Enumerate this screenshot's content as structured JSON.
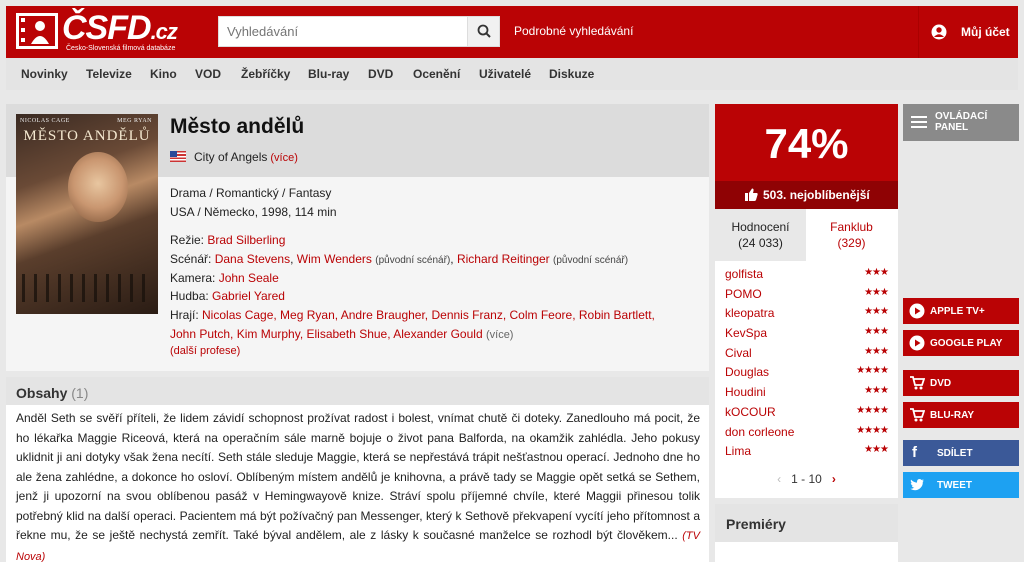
{
  "header": {
    "logo_text": "ČSFD",
    "logo_tld": ".cz",
    "logo_subtitle": "Česko-Slovenská filmová databáze",
    "search_placeholder": "Vyhledávání",
    "advanced_search": "Podrobné vyhledávání",
    "account_label": "Můj účet"
  },
  "nav": [
    "Novinky",
    "Televize",
    "Kino",
    "VOD",
    "Žebříčky",
    "Blu-ray",
    "DVD",
    "Ocenění",
    "Uživatelé",
    "Diskuze"
  ],
  "film": {
    "title": "Město andělů",
    "original_title": "City of Angels",
    "more": "(více)",
    "genres": "Drama / Romantický / Fantasy",
    "origin": "USA / Německo, 1998, 114 min",
    "poster": {
      "actor_left": "NICOLAS CAGE",
      "actor_right": "MEG RYAN",
      "title": "MĚSTO ANDĚLŮ"
    },
    "directing_label": "Režie:",
    "director": "Brad Silberling",
    "screenplay_label": "Scénář:",
    "screenplay_1": "Dana Stevens",
    "screenplay_2": "Wim Wenders",
    "screenplay_note": "(původní scénář)",
    "screenplay_3": "Richard Reitinger",
    "camera_label": "Kamera:",
    "camera": "John Seale",
    "music_label": "Hudba:",
    "music": "Gabriel Yared",
    "cast_label": "Hrají:",
    "cast_line1": "Nicolas Cage, Meg Ryan, Andre Braugher, Dennis Franz, Colm Feore, Robin Bartlett,",
    "cast_line2": "John Putch, Kim Murphy, Elisabeth Shue, Alexander Gould",
    "other_professions": "(další profese)"
  },
  "synopsis": {
    "title": "Obsahy",
    "count": "(1)",
    "text": "Anděl Seth se svěří příteli, že lidem závidí schopnost prožívat radost i bolest, vnímat chutě či doteky. Zanedlouho má pocit, že ho lékařka Maggie Riceová, která na operačním sále marně bojuje o život pana Balforda, na okamžik zahlédla. Jeho pokusy uklidnit ji ani dotyky však žena necítí. Seth stále sleduje Maggie, která se nepřestává trápit nešťastnou operací. Jednoho dne ho ale žena zahlédne, a dokonce ho osloví. Oblíbeným místem andělů je knihovna, a právě tady se Maggie opět setká se Sethem, jenž ji upozorní na svou oblíbenou pasáž v Hemingwayově knize. Stráví spolu příjemné chvíle, které Maggii přinesou tolik potřebný klid na další operaci. Pacientem má být požívačný pan Messenger, který k Sethově překvapení vycítí jeho přítomnost a řekne mu, že se ještě nechystá zemřít. Také býval andělem, ale z lásky k současné manželce se rozhodl být člověkem...",
    "source": "(TV Nova)"
  },
  "rating": {
    "value": "74%",
    "rank": "503. nejoblíbenější",
    "tab_ratings": "Hodnocení",
    "ratings_count": "(24 033)",
    "tab_fanclub": "Fanklub",
    "fanclub_count": "(329)",
    "raters": [
      {
        "name": "golfista",
        "stars": "★★★"
      },
      {
        "name": "POMO",
        "stars": "★★★"
      },
      {
        "name": "kleopatra",
        "stars": "★★★"
      },
      {
        "name": "KevSpa",
        "stars": "★★★"
      },
      {
        "name": "Cival",
        "stars": "★★★"
      },
      {
        "name": "Douglas",
        "stars": "★★★★"
      },
      {
        "name": "Houdini",
        "stars": "★★★"
      },
      {
        "name": "kOCOUR",
        "stars": "★★★★"
      },
      {
        "name": "don corleone",
        "stars": "★★★★"
      },
      {
        "name": "Lima",
        "stars": "★★★"
      }
    ],
    "pager": "1 - 10",
    "premieres": "Premiéry"
  },
  "sidebar": {
    "control_panel_line1": "OVLÁDACÍ",
    "control_panel_line2": "PANEL",
    "apple": "APPLE TV+",
    "google": "GOOGLE PLAY",
    "dvd": "DVD",
    "bluray": "BLU-RAY",
    "share": "SDÍLET",
    "tweet": "TWEET"
  },
  "colors": {
    "brand": "#ba0305",
    "facebook": "#3b5998",
    "twitter": "#1da1f2"
  }
}
